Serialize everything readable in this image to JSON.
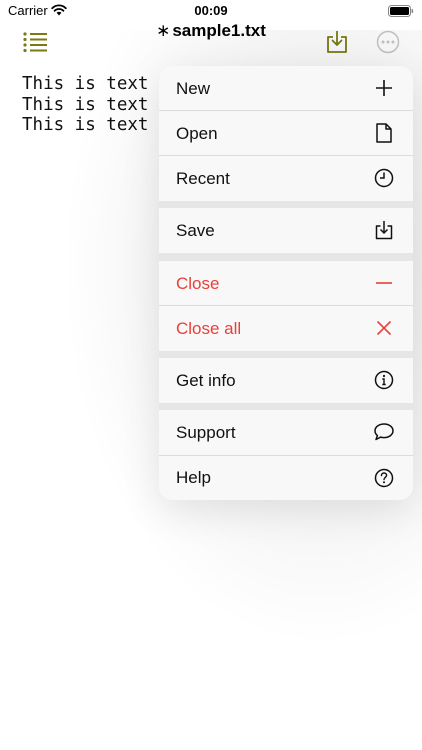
{
  "status_bar": {
    "carrier": "Carrier",
    "time": "00:09"
  },
  "nav": {
    "modified_marker": "∗",
    "title": "sample1.txt"
  },
  "editor": {
    "lines": [
      "This is text",
      "This is text",
      "This is text"
    ]
  },
  "menu": {
    "items": [
      {
        "label": "New",
        "icon": "plus-icon"
      },
      {
        "label": "Open",
        "icon": "document-icon"
      },
      {
        "label": "Recent",
        "icon": "clock-icon"
      },
      {
        "label": "Save",
        "icon": "save-tray-icon"
      },
      {
        "label": "Close",
        "icon": "minus-icon"
      },
      {
        "label": "Close all",
        "icon": "close-x-icon"
      },
      {
        "label": "Get info",
        "icon": "info-icon"
      },
      {
        "label": "Support",
        "icon": "speech-bubble-icon"
      },
      {
        "label": "Help",
        "icon": "help-question-icon"
      }
    ]
  },
  "colors": {
    "accent_olive": "#7b7a12",
    "destructive_red": "#e8413a",
    "menu_background": "#f8f8f9",
    "menu_group_gap": "#e6e6e8"
  }
}
